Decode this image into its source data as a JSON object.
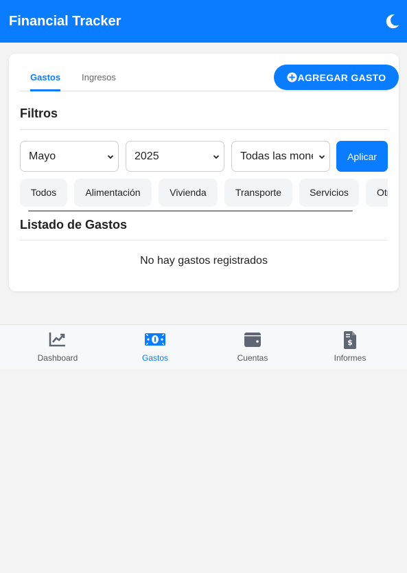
{
  "header": {
    "title": "Financial Tracker",
    "theme_icon": "moon-icon"
  },
  "tabs": [
    {
      "label": "Gastos",
      "active": true
    },
    {
      "label": "Ingresos",
      "active": false
    }
  ],
  "add_button": {
    "label": "AGREGAR GASTO",
    "icon": "plus-circle-icon"
  },
  "filters": {
    "title": "Filtros",
    "month": "Mayo",
    "year": "2025",
    "currency": "Todas las monedas",
    "apply_label": "Aplicar"
  },
  "categories": [
    "Todos",
    "Alimentación",
    "Vivienda",
    "Transporte",
    "Servicios",
    "Otros"
  ],
  "list": {
    "title": "Listado de Gastos",
    "empty_message": "No hay gastos registrados"
  },
  "nav": [
    {
      "label": "Dashboard",
      "icon": "chart-line-icon",
      "active": false
    },
    {
      "label": "Gastos",
      "icon": "money-bill-icon",
      "active": true
    },
    {
      "label": "Cuentas",
      "icon": "wallet-icon",
      "active": false
    },
    {
      "label": "Informes",
      "icon": "invoice-dollar-icon",
      "active": false
    }
  ],
  "colors": {
    "primary": "#0a7cff",
    "background": "#f3f3f3",
    "card": "#ffffff",
    "nav_inactive": "#5f6673"
  }
}
